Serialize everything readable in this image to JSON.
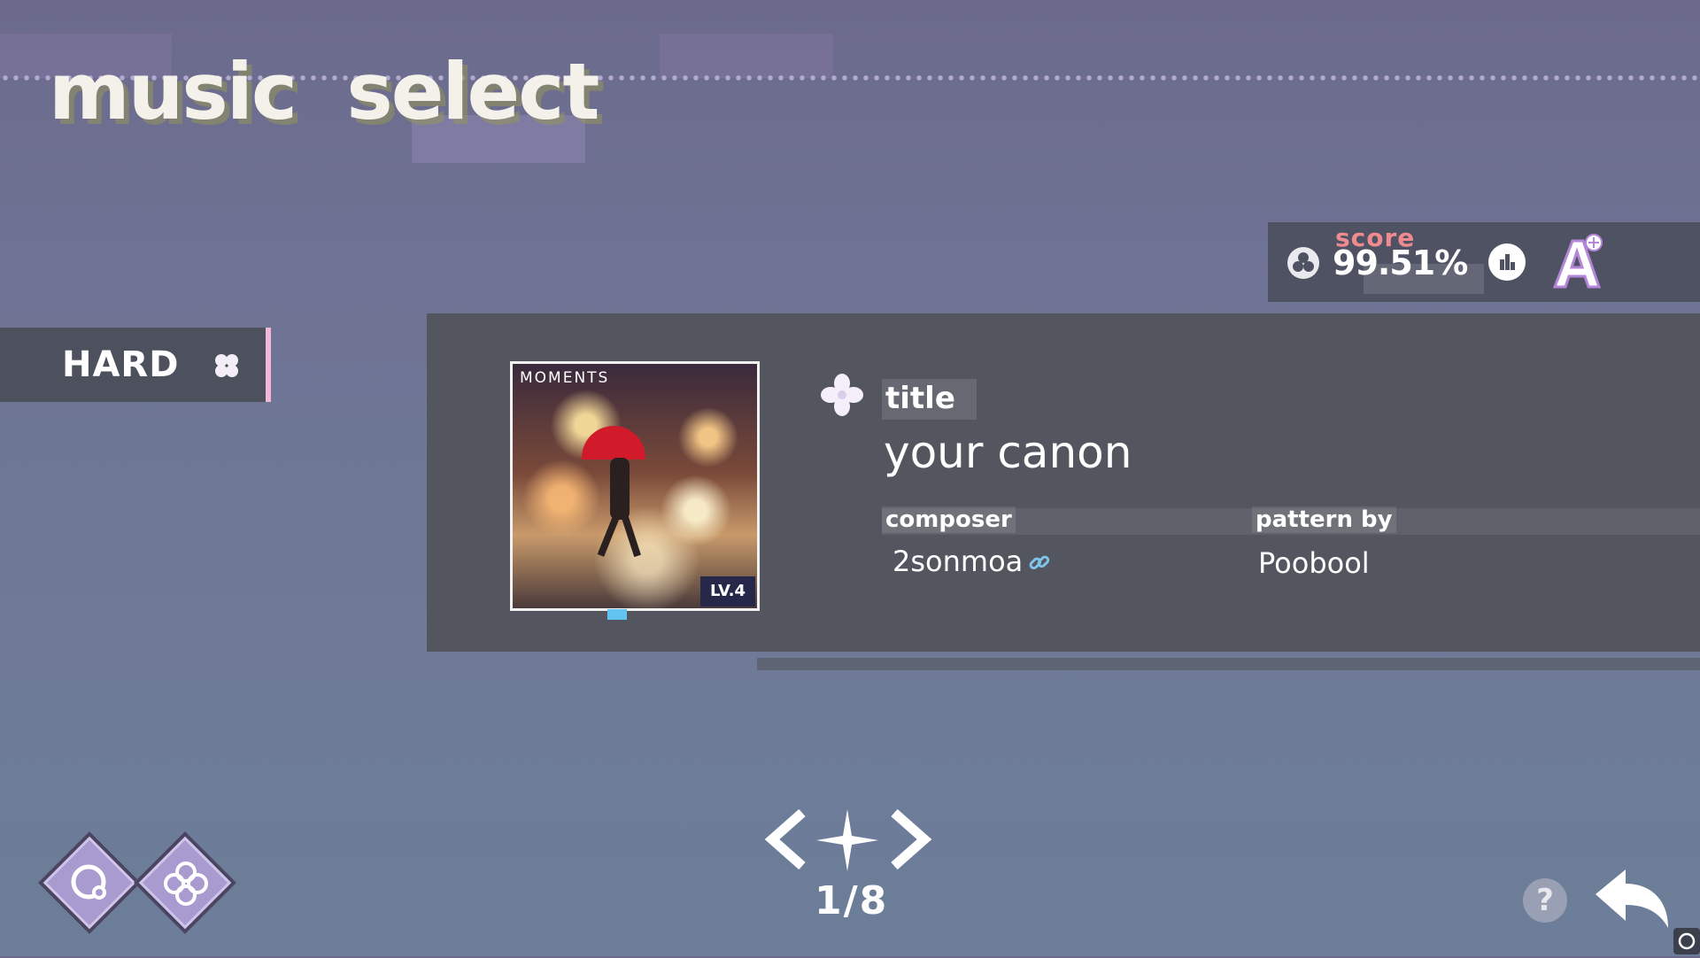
{
  "header": {
    "title": "music  select"
  },
  "score": {
    "label": "score",
    "value": "99.51%",
    "rank": "A"
  },
  "difficulty": {
    "label": "HARD"
  },
  "song": {
    "jacket_text": "MOMENTS",
    "level_badge": "LV.4",
    "title_label": "title",
    "title": "your canon",
    "composer_label": "composer",
    "composer": "2sonmoa",
    "pattern_label": "pattern  by",
    "pattern_by": "Poobool"
  },
  "navigation": {
    "page": "1/8"
  },
  "footer": {
    "help": "?"
  },
  "colors": {
    "accent_pink": "#f2b6d8",
    "score_label": "#ef8a90",
    "panel": "#53555f",
    "button_purple": "#a99acf"
  }
}
